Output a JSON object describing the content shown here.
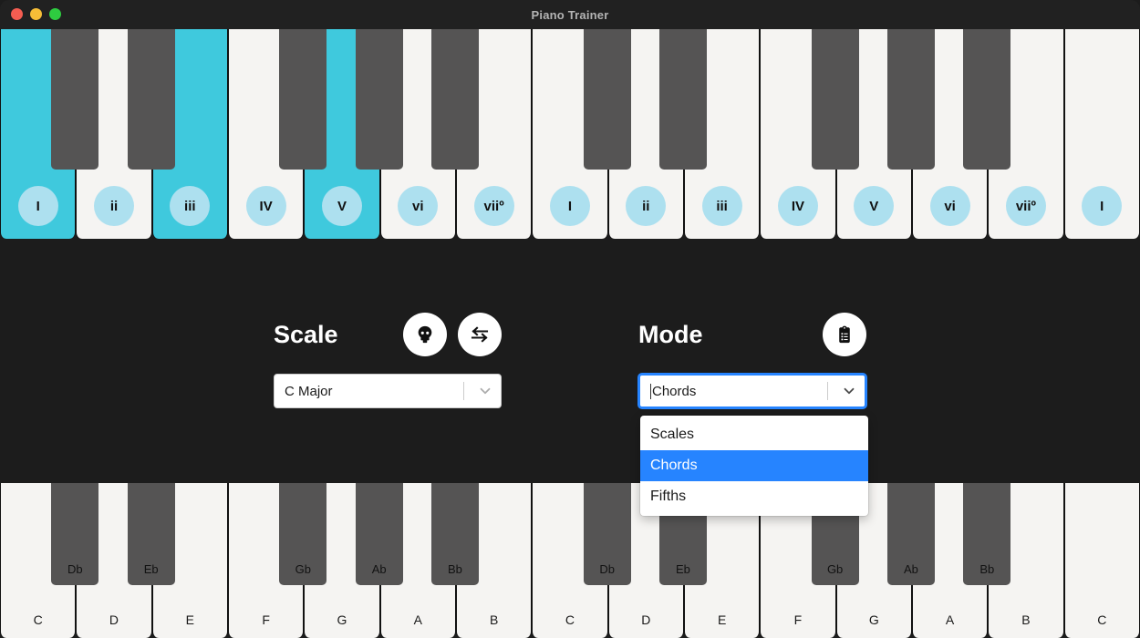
{
  "window": {
    "title": "Piano Trainer",
    "traffic_lights": [
      "close-button",
      "minimize-button",
      "maximize-button"
    ]
  },
  "colors": {
    "accent_cyan": "#3fc9dd",
    "degree_badge": "#ade0ef",
    "focus_blue": "#2684ff",
    "panel_bg": "#1c1c1c",
    "white_key": "#f5f4f2",
    "black_key": "#555454"
  },
  "top_keyboard": {
    "name": "scale-degree-keyboard",
    "white_keys": [
      {
        "degree": "I",
        "active": true
      },
      {
        "degree": "ii",
        "active": false
      },
      {
        "degree": "iii",
        "active": true
      },
      {
        "degree": "IV",
        "active": false
      },
      {
        "degree": "V",
        "active": true
      },
      {
        "degree": "vi",
        "active": false
      },
      {
        "degree": "viiº",
        "active": false
      },
      {
        "degree": "I",
        "active": false
      },
      {
        "degree": "ii",
        "active": false
      },
      {
        "degree": "iii",
        "active": false
      },
      {
        "degree": "IV",
        "active": false
      },
      {
        "degree": "V",
        "active": false
      },
      {
        "degree": "vi",
        "active": false
      },
      {
        "degree": "viiº",
        "active": false
      },
      {
        "degree": "I",
        "active": false
      }
    ],
    "black_key_after_white_index": [
      0,
      1,
      3,
      4,
      5,
      7,
      8,
      10,
      11,
      12
    ]
  },
  "bottom_keyboard": {
    "name": "note-name-keyboard",
    "white_keys": [
      {
        "note": "C"
      },
      {
        "note": "D"
      },
      {
        "note": "E"
      },
      {
        "note": "F"
      },
      {
        "note": "G"
      },
      {
        "note": "A"
      },
      {
        "note": "B"
      },
      {
        "note": "C"
      },
      {
        "note": "D"
      },
      {
        "note": "E"
      },
      {
        "note": "F"
      },
      {
        "note": "G"
      },
      {
        "note": "A"
      },
      {
        "note": "B"
      },
      {
        "note": "C"
      }
    ],
    "black_keys": [
      {
        "after_white_index": 0,
        "note": "Db"
      },
      {
        "after_white_index": 1,
        "note": "Eb"
      },
      {
        "after_white_index": 3,
        "note": "Gb"
      },
      {
        "after_white_index": 4,
        "note": "Ab"
      },
      {
        "after_white_index": 5,
        "note": "Bb"
      },
      {
        "after_white_index": 7,
        "note": "Db"
      },
      {
        "after_white_index": 8,
        "note": "Eb"
      },
      {
        "after_white_index": 10,
        "note": "Gb"
      },
      {
        "after_white_index": 11,
        "note": "Ab"
      },
      {
        "after_white_index": 12,
        "note": "Bb"
      }
    ]
  },
  "panel": {
    "scale": {
      "title": "Scale",
      "select_value": "C Major",
      "buttons": [
        {
          "icon": "skull-icon",
          "name": "difficulty-skull-button"
        },
        {
          "icon": "swap-arrows-icon",
          "name": "swap-hands-button"
        }
      ]
    },
    "mode": {
      "title": "Mode",
      "select_value": "Chords",
      "focused": true,
      "buttons": [
        {
          "icon": "clipboard-list-icon",
          "name": "practice-log-button"
        }
      ],
      "menu_open": true,
      "options": [
        {
          "label": "Scales",
          "selected": false
        },
        {
          "label": "Chords",
          "selected": true
        },
        {
          "label": "Fifths",
          "selected": false
        }
      ]
    }
  }
}
